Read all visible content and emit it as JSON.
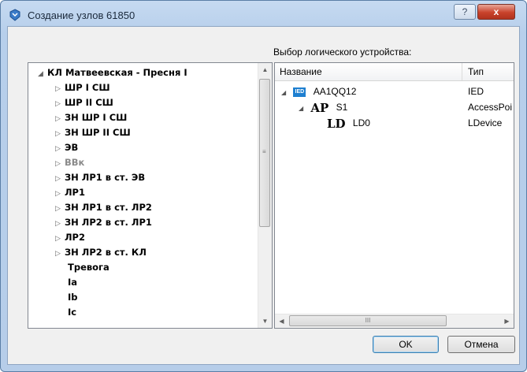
{
  "window": {
    "title": "Создание узлов 61850",
    "help_symbol": "?",
    "close_symbol": "x"
  },
  "left_tree": {
    "items": [
      {
        "label": "КЛ Матвеевская - Пресня I",
        "expanded": true,
        "level": 0
      },
      {
        "label": "ШР I СШ",
        "level": 1
      },
      {
        "label": "ШР II СШ",
        "level": 1
      },
      {
        "label": "ЗН ШР I СШ",
        "level": 1
      },
      {
        "label": "ЗН ШР II СШ",
        "level": 1
      },
      {
        "label": "ЭВ",
        "level": 1
      },
      {
        "label": "ВВк",
        "level": 1,
        "disabled": true
      },
      {
        "label": "ЗН ЛР1 в ст. ЭВ",
        "level": 1
      },
      {
        "label": "ЛР1",
        "level": 1
      },
      {
        "label": "ЗН ЛР1 в ст. ЛР2",
        "level": 1
      },
      {
        "label": "ЗН ЛР2 в ст. ЛР1",
        "level": 1
      },
      {
        "label": "ЛР2",
        "level": 1
      },
      {
        "label": "ЗН ЛР2 в ст. КЛ",
        "level": 1
      },
      {
        "label": "Тревога",
        "level": 1,
        "leaf": true
      },
      {
        "label": "Ia",
        "level": 1,
        "leaf": true
      },
      {
        "label": "Ib",
        "level": 1,
        "leaf": true
      },
      {
        "label": "Ic",
        "level": 1,
        "leaf": true
      }
    ]
  },
  "right_panel": {
    "label": "Выбор логического устройства:",
    "columns": {
      "name": "Название",
      "type": "Тип"
    },
    "rows": [
      {
        "icon": "IED",
        "name": "AA1QQ12",
        "type": "IED"
      },
      {
        "icon": "AP",
        "name": "S1",
        "type": "AccessPoi"
      },
      {
        "icon": "LD",
        "name": "LD0",
        "type": "LDevice"
      }
    ]
  },
  "buttons": {
    "ok": "OK",
    "cancel": "Отмена"
  },
  "glyphs": {
    "expanded": "◢",
    "collapsed": "▷",
    "scroll_up": "▲",
    "scroll_down": "▼",
    "scroll_left": "◀",
    "scroll_right": "▶",
    "grip": "≡",
    "hgrip": "III"
  }
}
